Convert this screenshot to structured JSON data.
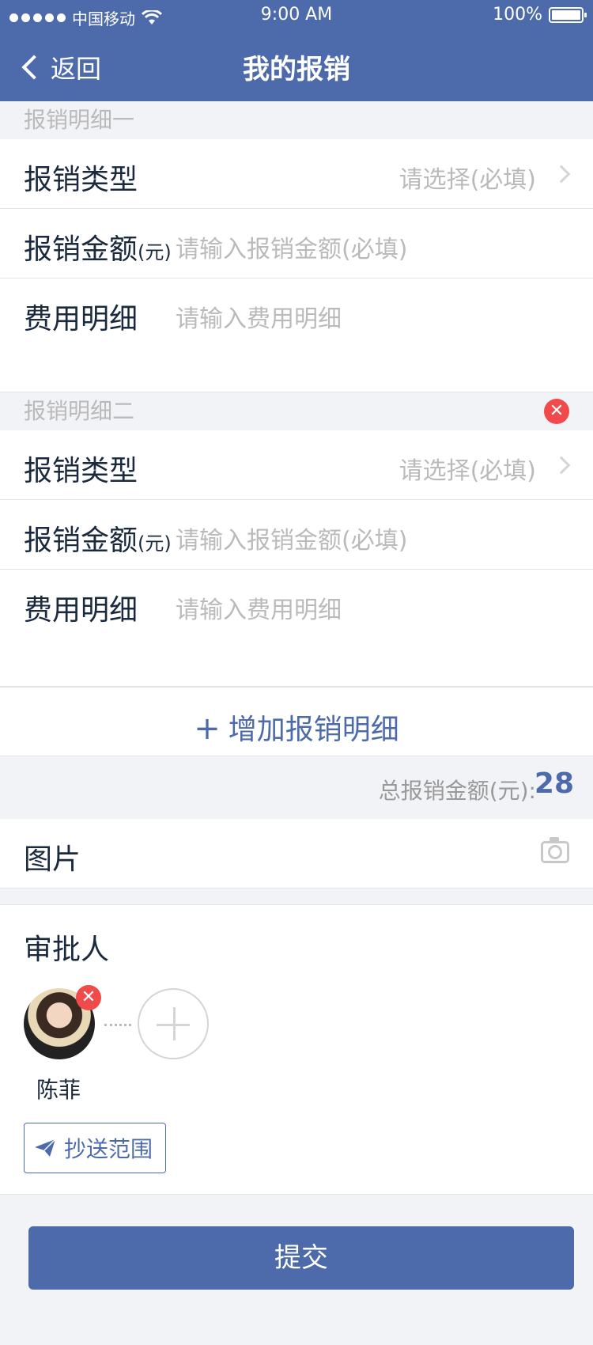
{
  "status_bar": {
    "carrier": "中国移动",
    "time": "9:00 AM",
    "battery": "100%",
    "signal_icon": "signal-dots-icon",
    "wifi_icon": "wifi-icon"
  },
  "nav": {
    "back_label": "返回",
    "title": "我的报销"
  },
  "details": [
    {
      "section_title": "报销明细一",
      "type_label": "报销类型",
      "type_placeholder": "请选择(必填)",
      "amount_label": "报销金额",
      "amount_unit": "(元)",
      "amount_placeholder": "请输入报销金额(必填)",
      "desc_label": "费用明细",
      "desc_placeholder": "请输入费用明细"
    },
    {
      "section_title": "报销明细二",
      "type_label": "报销类型",
      "type_placeholder": "请选择(必填)",
      "amount_label": "报销金额",
      "amount_unit": "(元)",
      "amount_placeholder": "请输入报销金额(必填)",
      "desc_label": "费用明细",
      "desc_placeholder": "请输入费用明细"
    }
  ],
  "add_detail": {
    "label": "增加报销明细"
  },
  "total": {
    "label": "总报销金额(元):",
    "value": "28"
  },
  "pictures": {
    "label": "图片"
  },
  "approver": {
    "title": "审批人",
    "name": "陈菲"
  },
  "cc": {
    "label": "抄送范围"
  },
  "submit": {
    "label": "提交"
  },
  "colors": {
    "primary": "#4D6BAB",
    "text": "#1A293E",
    "placeholder": "#BABABA",
    "muted": "#999999",
    "danger": "#F04A4A",
    "background": "#F2F3F7"
  }
}
